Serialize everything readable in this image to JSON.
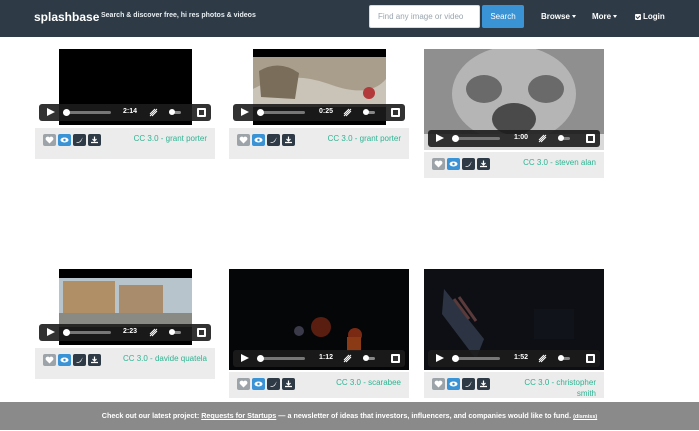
{
  "nav": {
    "brand": "splashbase",
    "tagline": "Search & discover free, hi res photos & videos",
    "search_placeholder": "Find any image or video",
    "search_button": "Search",
    "browse": "Browse",
    "more": "More",
    "login": "Login"
  },
  "cards": [
    {
      "time": "2:14",
      "license": "CC 3.0 - grant porter",
      "icon": "heart-icon"
    },
    {
      "time": "0:25",
      "license": "CC 3.0 - grant porter"
    },
    {
      "time": "1:00",
      "license": "CC 3.0 - steven alan"
    },
    {
      "time": "2:23",
      "license": "CC 3.0 - davide quatela"
    },
    {
      "time": "1:12",
      "license": "CC 3.0 - scarabee"
    },
    {
      "time": "1:52",
      "license": "CC 3.0 - christopher smith"
    }
  ],
  "banner": {
    "prefix": "Check out our latest project: ",
    "link": "Requests for Startups",
    "suffix": " — a newsletter of ideas that investors, influencers, and companies would like to fund. ",
    "dismiss": "(dismiss)"
  },
  "colors": {
    "navbar": "#2e3b47",
    "accent": "#3a93d4",
    "license_link": "#2db493",
    "banner": "#8a8a8a"
  }
}
